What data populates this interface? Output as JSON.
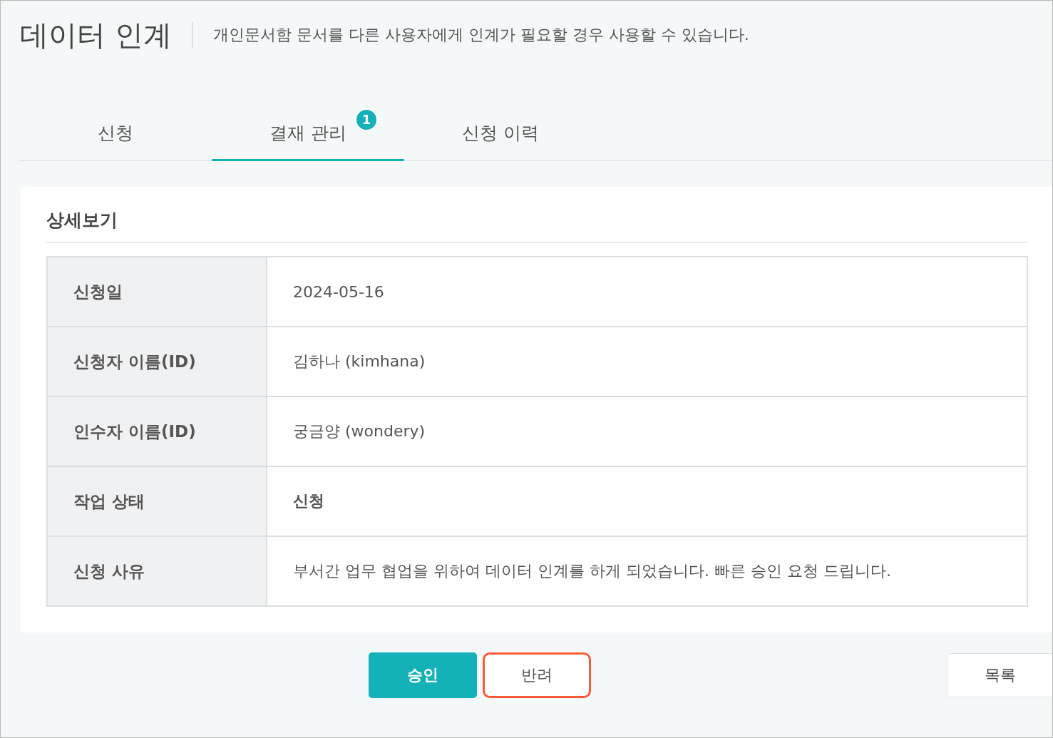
{
  "header": {
    "title": "데이터 인계",
    "description": "개인문서함 문서를 다른 사용자에게 인계가 필요할 경우 사용할 수 있습니다."
  },
  "tabs": [
    {
      "label": "신청",
      "selected": false
    },
    {
      "label": "결재 관리",
      "selected": true,
      "badge": "1"
    },
    {
      "label": "신청 이력",
      "selected": false
    }
  ],
  "detail": {
    "title": "상세보기",
    "rows": [
      {
        "label": "신청일",
        "value": "2024-05-16",
        "bold": false
      },
      {
        "label": "신청자 이름(ID)",
        "value": "김하나 (kimhana)",
        "bold": false
      },
      {
        "label": "인수자 이름(ID)",
        "value": "궁금양 (wondery)",
        "bold": false
      },
      {
        "label": "작업 상태",
        "value": "신청",
        "bold": true
      },
      {
        "label": "신청 사유",
        "value": "부서간 업무 협업을 위하여 데이터 인계를 하게 되었습니다. 빠른 승인 요청 드립니다.",
        "bold": false
      }
    ]
  },
  "actions": [
    {
      "label": "승인",
      "kind": "primary",
      "highlighted": false
    },
    {
      "label": "반려",
      "kind": "secondary",
      "highlighted": true
    }
  ],
  "list_button": {
    "label": "목록"
  }
}
